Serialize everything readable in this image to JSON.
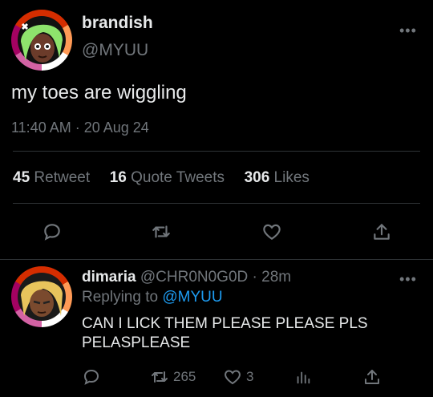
{
  "tweet": {
    "display_name": "brandish",
    "handle": "@MYUU",
    "text": "my toes are wiggling",
    "timestamp": "11:40 AM · 20 Aug 24",
    "stats": {
      "retweets_count": "45",
      "retweets_label": "Retweet",
      "quotes_count": "16",
      "quotes_label": "Quote Tweets",
      "likes_count": "306",
      "likes_label": "Likes"
    },
    "more_label": "•••",
    "actions": [
      "reply-icon",
      "retweet-icon",
      "like-icon",
      "share-icon"
    ]
  },
  "reply": {
    "display_name": "dimaria",
    "handle": "@CHR0N0G0D",
    "separator": "·",
    "time_ago": "28m",
    "replying_prefix": "Replying to",
    "replying_handle": "@MYUU",
    "text_line1": "CAN I LICK THEM PLEASE PLEASE PLS",
    "text_line2": "PELASPLEASE",
    "retweet_count": "265",
    "like_count": "3",
    "more_label": "•••",
    "actions": [
      "reply-icon",
      "retweet-icon",
      "like-icon",
      "analytics-icon",
      "share-icon"
    ]
  },
  "colors": {
    "background": "#000000",
    "text": "#e7e9ea",
    "muted": "#71767b",
    "accent": "#1d9bf0",
    "divider": "#2f3336"
  }
}
